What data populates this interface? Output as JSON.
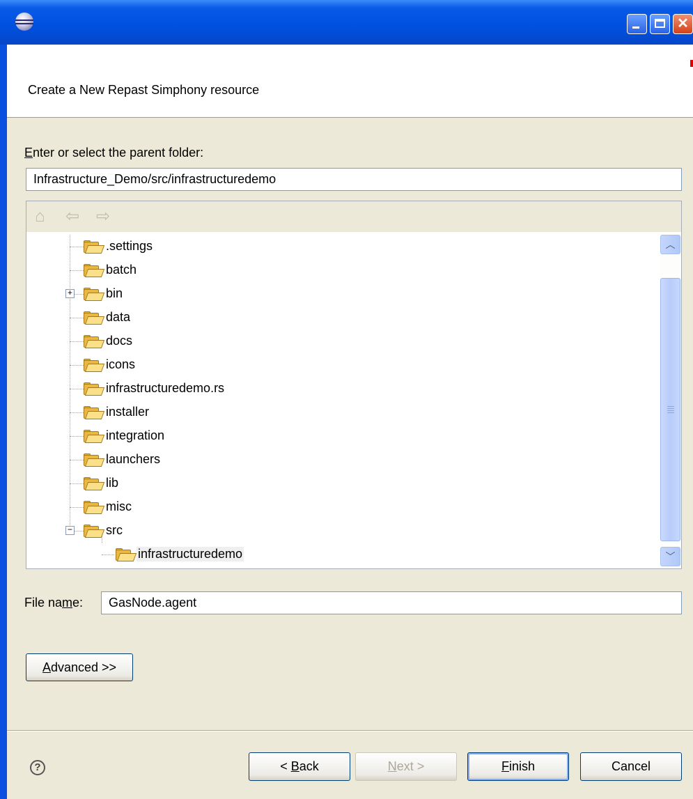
{
  "window": {
    "title": ""
  },
  "header": {
    "title": "Create a New Repast Simphony resource"
  },
  "parent_folder": {
    "label": "Enter or select the parent folder:",
    "value": "Infrastructure_Demo/src/infrastructuredemo"
  },
  "tree": {
    "items": [
      {
        "label": ".settings",
        "expander": ""
      },
      {
        "label": "batch",
        "expander": ""
      },
      {
        "label": "bin",
        "expander": "+"
      },
      {
        "label": "data",
        "expander": ""
      },
      {
        "label": "docs",
        "expander": ""
      },
      {
        "label": "icons",
        "expander": ""
      },
      {
        "label": "infrastructuredemo.rs",
        "expander": ""
      },
      {
        "label": "installer",
        "expander": ""
      },
      {
        "label": "integration",
        "expander": ""
      },
      {
        "label": "launchers",
        "expander": ""
      },
      {
        "label": "lib",
        "expander": ""
      },
      {
        "label": "misc",
        "expander": ""
      },
      {
        "label": "src",
        "expander": "−"
      },
      {
        "label": "infrastructuredemo",
        "expander": "",
        "selected": true
      }
    ]
  },
  "file_name": {
    "label": "File name:",
    "value": "GasNode.agent"
  },
  "buttons": {
    "advanced": "Advanced >>",
    "back": "< Back",
    "next": "Next >",
    "finish": "Finish",
    "cancel": "Cancel"
  },
  "icons": {
    "help": "?",
    "close": "✕",
    "home": "home-icon",
    "back_arrow": "back-arrow-icon",
    "forward_arrow": "forward-arrow-icon"
  },
  "colors": {
    "title_bar": "#0a5ae8",
    "selection": "#efefef",
    "folder": "#e8b840"
  }
}
